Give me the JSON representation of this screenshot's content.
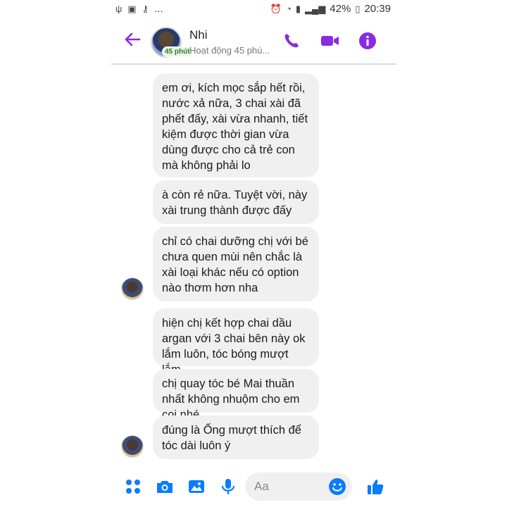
{
  "status": {
    "left_icons": [
      "usb-icon",
      "photo-icon",
      "key-icon",
      "more-dots-icon"
    ],
    "dots": "...",
    "battery_pct": "42%",
    "time": "20:39"
  },
  "header": {
    "name": "Nhi",
    "badge": "45 phút",
    "presence": "Hoạt động 45 phú..."
  },
  "messages": [
    {
      "text": "em ơi, kích mọc sắp hết rồi, nước xả nữa, 3 chai xài đã phết đấy, xài vừa nhanh, tiết kiệm được thời gian vừa dùng được cho cả trẻ con mà không phải lo"
    },
    {
      "text": "à còn rẻ nữa. Tuyệt vời, này xài trung thành được đấy"
    },
    {
      "text": "chỉ có chai dưỡng chị với bé chưa quen mùi nên chắc là xài loại khác nếu có option nào thơm hơn nha"
    },
    {
      "text": "hiện chị kết hợp chai dầu argan với 3 chai bên này ok lắm luôn, tóc bóng mượt lắm"
    },
    {
      "text": "chị quay tóc bé Mai thuần nhất không nhuộm cho em coi nhé"
    },
    {
      "text": "đúng là Ống mượt thích để tóc dài luôn ý"
    }
  ],
  "composer": {
    "placeholder": "Aa"
  },
  "colors": {
    "accent": "#8a2be2",
    "bubble": "#f1f0f0",
    "messenger_blue": "#0a7cff"
  }
}
